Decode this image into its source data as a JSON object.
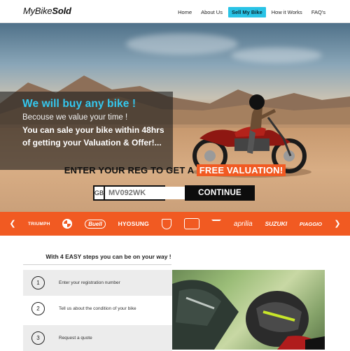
{
  "header": {
    "logo_light": "MyBike",
    "logo_bold": "Sold",
    "nav": [
      {
        "label": "Home",
        "active": false
      },
      {
        "label": "About Us",
        "active": false
      },
      {
        "label": "Sell My Bike",
        "active": true
      },
      {
        "label": "How it Works",
        "active": false
      },
      {
        "label": "FAQ's",
        "active": false
      }
    ]
  },
  "hero": {
    "title": "We will buy any bike !",
    "subtitle": "Becouse we value your time !",
    "body": "You can sale your bike within 48hrs of getting your Valuation & Offer!...",
    "cta_prefix": "ENTER YOUR REG TO GET A",
    "cta_highlight": "FREE VALUATION!",
    "reg_prefix": "GB",
    "reg_placeholder": "MV092WK",
    "continue_label": "CONTINUE"
  },
  "brands": [
    "TRIUMPH",
    "bmw-logo",
    "Buell",
    "HYOSUNG",
    "ducati-logo",
    "harley-davidson-logo",
    "honda-logo",
    "aprilia",
    "SUZUKI",
    "PIAGGIO"
  ],
  "steps": {
    "heading": "With 4 EASY steps you can be on your way !",
    "items": [
      {
        "num": "1",
        "text": "Enter your registration number"
      },
      {
        "num": "2",
        "text": "Tell us about the condition of your bike"
      },
      {
        "num": "3",
        "text": "Request a quote"
      }
    ]
  },
  "colors": {
    "accent_blue": "#29c3e6",
    "accent_orange": "#f15a22",
    "dark": "#0d0d0d"
  }
}
